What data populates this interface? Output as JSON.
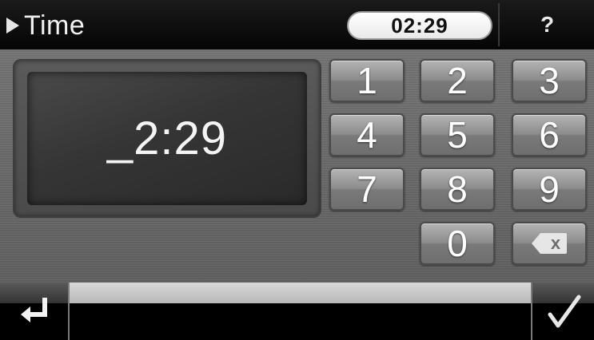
{
  "header": {
    "title": "Time",
    "clock": "02:29",
    "help_label": "?"
  },
  "display": {
    "value": "_2:29"
  },
  "keypad": {
    "keys": [
      "1",
      "2",
      "3",
      "4",
      "5",
      "6",
      "7",
      "8",
      "9",
      "0"
    ],
    "backspace_icon": "backspace-icon",
    "backspace_glyph": "x"
  },
  "footer": {
    "back_icon": "return-arrow-icon",
    "confirm_icon": "checkmark-icon"
  },
  "colors": {
    "panel": "#6e6e6e",
    "key": "#8c8c8c",
    "header": "#000000"
  }
}
